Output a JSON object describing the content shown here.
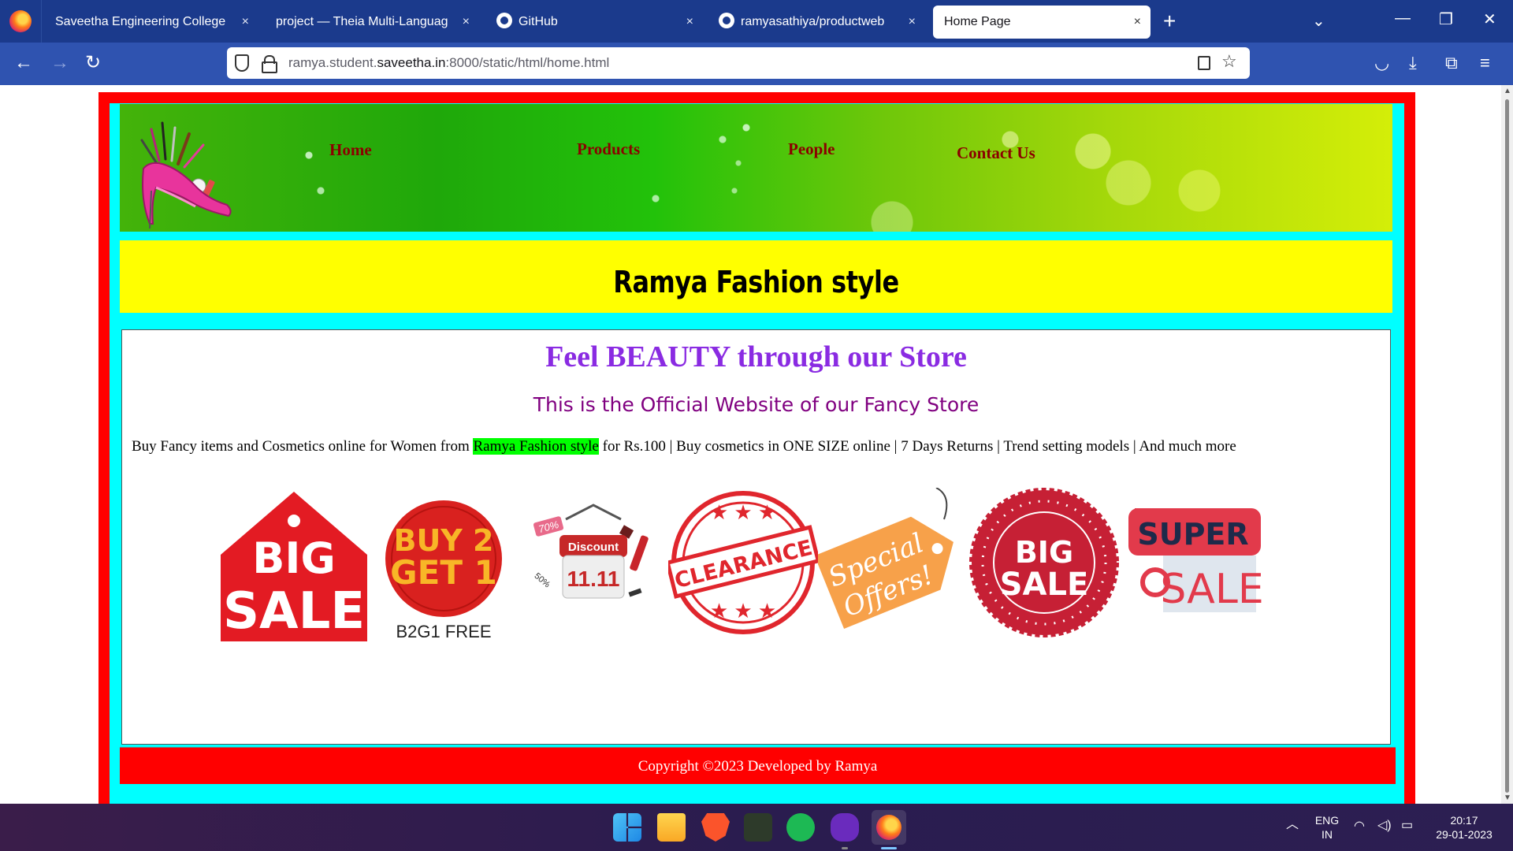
{
  "browser": {
    "tabs": [
      {
        "title": "Saveetha Engineering College",
        "active": false
      },
      {
        "title": "project — Theia Multi-Language Ex",
        "active": false
      },
      {
        "title": "GitHub",
        "active": false
      },
      {
        "title": "ramyasathiya/productweb",
        "active": false
      },
      {
        "title": "Home Page",
        "active": true
      }
    ],
    "url_prefix": "ramya.student.",
    "url_domain": "saveetha.in",
    "url_suffix": ":8000/static/html/home.html",
    "icons": {
      "close": "×",
      "new_tab": "+",
      "tab_list": "⌄",
      "minimize": "—",
      "restore": "❐",
      "window_close": "✕",
      "back": "←",
      "forward": "→",
      "reload": "↻",
      "star": "☆",
      "pocket": "◡",
      "download": "⤓",
      "extensions": "⧉",
      "menu": "≡"
    }
  },
  "page": {
    "nav": {
      "home": "Home",
      "products": "Products",
      "people": "People",
      "contact": "Contact Us"
    },
    "site_title": "Ramya Fashion style",
    "tagline": "Feel BEAUTY through our Store",
    "subtitle": "This is the Official Website of our Fancy Store",
    "description": {
      "before": "Buy Fancy items and Cosmetics online for Women from ",
      "highlight": "Ramya Fashion style",
      "after": " for Rs.100 | Buy cosmetics in ONE SIZE online | 7 Days Returns | Trend setting models | And much more"
    },
    "badges": {
      "big_sale_1": {
        "line1": "BIG",
        "line2": "SALE"
      },
      "buy2get1": {
        "line1": "BUY 2",
        "line2": "GET 1",
        "caption": "B2G1 FREE"
      },
      "discount": {
        "label": "Discount",
        "date": "11.11",
        "pct1": "70%",
        "pct2": "50%"
      },
      "clearance": {
        "text": "CLEARANCE"
      },
      "special": {
        "line1": "Special",
        "line2": "Offers!"
      },
      "big_sale_2": {
        "line1": "BIG",
        "line2": "SALE"
      },
      "super_sale": {
        "line1": "SUPER",
        "line2": "SALE"
      }
    },
    "footer": "Copyright ©2023 Developed by Ramya",
    "colors": {
      "frame": "#ff0000",
      "inner_frame": "#00ffff",
      "title_bg": "#ffff00",
      "nav_text": "#8b0000",
      "tagline": "#8a2be2",
      "subtitle": "#800080",
      "highlight": "#00ff00"
    }
  },
  "taskbar": {
    "apps": [
      "windows-start",
      "file-explorer",
      "brave-browser",
      "game-app",
      "spotify",
      "mask-app",
      "firefox"
    ],
    "lang": "ENG",
    "region": "IN",
    "time": "20:17",
    "date": "29-01-2023",
    "tray_arrow": "︿"
  }
}
